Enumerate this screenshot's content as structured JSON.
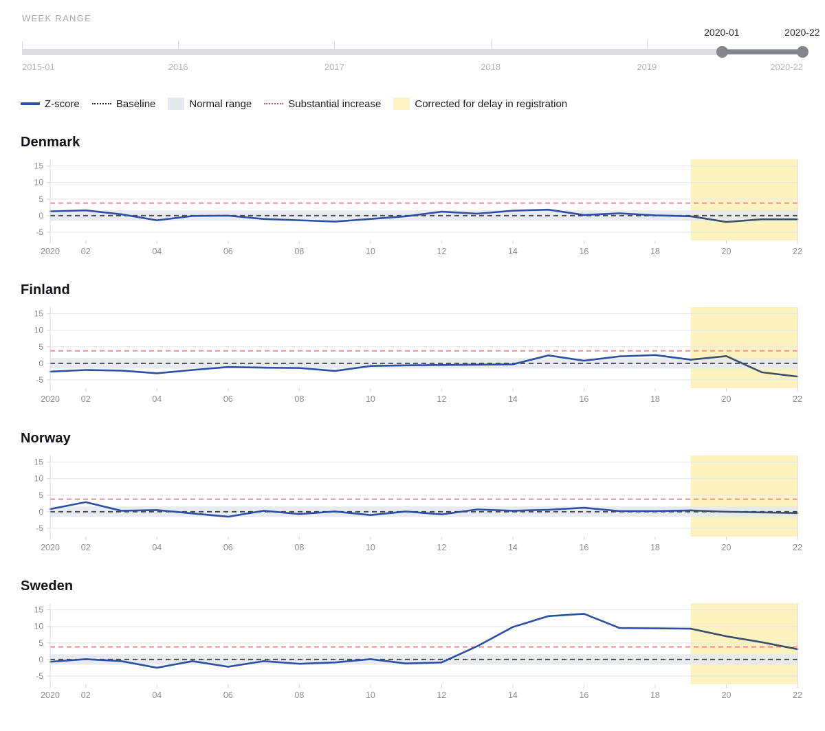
{
  "slider": {
    "label": "WEEK RANGE",
    "min_label": "2015-01",
    "max_label": "2020-22",
    "selected_start": "2020-01",
    "selected_end": "2020-22",
    "ticks": [
      "2015-01",
      "2016",
      "2017",
      "2018",
      "2019",
      "2020-22"
    ],
    "track_color": "#dcdcde",
    "fill_color": "#84848c",
    "handle_color": "#84848c"
  },
  "legend": {
    "items": [
      {
        "label": "Z-score",
        "type": "line",
        "color": "#2b4fa2"
      },
      {
        "label": "Baseline",
        "type": "dotted",
        "color": "#2b2b30"
      },
      {
        "label": "Normal range",
        "type": "swatch",
        "color": "#e4e9ef"
      },
      {
        "label": "Substantial increase",
        "type": "dotted-red",
        "color": "#e0555f"
      },
      {
        "label": "Corrected for delay in registration",
        "type": "swatch",
        "color": "#fcf2c4"
      }
    ]
  },
  "chart_data": [
    {
      "type": "line",
      "title": "Denmark",
      "xlabel": "",
      "ylabel": "",
      "x": [
        1,
        2,
        3,
        4,
        5,
        6,
        7,
        8,
        9,
        10,
        11,
        12,
        13,
        14,
        15,
        16,
        17,
        18,
        19,
        20,
        21,
        22
      ],
      "xtick_values": [
        1,
        2,
        4,
        6,
        8,
        10,
        12,
        14,
        16,
        18,
        20,
        22
      ],
      "xtick_labels": [
        "2020",
        "02",
        "04",
        "06",
        "08",
        "10",
        "12",
        "14",
        "16",
        "18",
        "20",
        "22"
      ],
      "ytick_values": [
        -5,
        0,
        5,
        10,
        15
      ],
      "ytick_labels": [
        "-5",
        "0",
        "5",
        "10",
        "15"
      ],
      "ylim": [
        -7.5,
        17.0
      ],
      "xlim": [
        1,
        22
      ],
      "series": [
        {
          "name": "Z-score",
          "values": [
            1.3,
            1.6,
            0.4,
            -1.4,
            -0.1,
            0.0,
            -1.0,
            -1.4,
            -1.8,
            -1.0,
            -0.2,
            1.2,
            0.6,
            1.5,
            1.8,
            0.2,
            0.7,
            0.1,
            -0.2,
            -1.9,
            -1.1,
            -1.1
          ]
        }
      ],
      "baseline": 0,
      "normal_range": [
        -1.6,
        1.6
      ],
      "substantial_increase": 3.8,
      "corrected_from": 19,
      "grid": true
    },
    {
      "type": "line",
      "title": "Finland",
      "xlabel": "",
      "ylabel": "",
      "x": [
        1,
        2,
        3,
        4,
        5,
        6,
        7,
        8,
        9,
        10,
        11,
        12,
        13,
        14,
        15,
        16,
        17,
        18,
        19,
        20,
        21,
        22
      ],
      "xtick_values": [
        1,
        2,
        4,
        6,
        8,
        10,
        12,
        14,
        16,
        18,
        20,
        22
      ],
      "xtick_labels": [
        "2020",
        "02",
        "04",
        "06",
        "08",
        "10",
        "12",
        "14",
        "16",
        "18",
        "20",
        "22"
      ],
      "ytick_values": [
        -5,
        0,
        5,
        10,
        15
      ],
      "ytick_labels": [
        "-5",
        "0",
        "5",
        "10",
        "15"
      ],
      "ylim": [
        -7.5,
        17.0
      ],
      "xlim": [
        1,
        22
      ],
      "series": [
        {
          "name": "Z-score",
          "values": [
            -2.5,
            -2.0,
            -2.2,
            -3.0,
            -2.0,
            -1.1,
            -1.3,
            -1.4,
            -2.3,
            -0.8,
            -0.6,
            -0.5,
            -0.4,
            -0.3,
            2.4,
            0.8,
            2.1,
            2.5,
            1.1,
            2.2,
            -2.7,
            -4.0
          ]
        }
      ],
      "baseline": 0,
      "normal_range": [
        -1.6,
        1.6
      ],
      "substantial_increase": 3.8,
      "corrected_from": 19,
      "grid": true
    },
    {
      "type": "line",
      "title": "Norway",
      "xlabel": "",
      "ylabel": "",
      "x": [
        1,
        2,
        3,
        4,
        5,
        6,
        7,
        8,
        9,
        10,
        11,
        12,
        13,
        14,
        15,
        16,
        17,
        18,
        19,
        20,
        21,
        22
      ],
      "xtick_values": [
        1,
        2,
        4,
        6,
        8,
        10,
        12,
        14,
        16,
        18,
        20,
        22
      ],
      "xtick_labels": [
        "2020",
        "02",
        "04",
        "06",
        "08",
        "10",
        "12",
        "14",
        "16",
        "18",
        "20",
        "22"
      ],
      "ytick_values": [
        -5,
        0,
        5,
        10,
        15
      ],
      "ytick_labels": [
        "-5",
        "0",
        "5",
        "10",
        "15"
      ],
      "ylim": [
        -7.5,
        17.0
      ],
      "xlim": [
        1,
        22
      ],
      "series": [
        {
          "name": "Z-score",
          "values": [
            0.8,
            2.9,
            0.3,
            0.5,
            -0.5,
            -1.5,
            0.3,
            -0.7,
            0.1,
            -1.0,
            0.1,
            -0.8,
            0.7,
            0.3,
            0.6,
            1.2,
            0.2,
            0.2,
            0.4,
            0.0,
            -0.2,
            -0.4
          ]
        }
      ],
      "baseline": 0,
      "normal_range": [
        -1.6,
        1.6
      ],
      "substantial_increase": 3.8,
      "corrected_from": 19,
      "grid": true
    },
    {
      "type": "line",
      "title": "Sweden",
      "xlabel": "",
      "ylabel": "",
      "x": [
        1,
        2,
        3,
        4,
        5,
        6,
        7,
        8,
        9,
        10,
        11,
        12,
        13,
        14,
        15,
        16,
        17,
        18,
        19,
        20,
        21,
        22
      ],
      "xtick_values": [
        1,
        2,
        4,
        6,
        8,
        10,
        12,
        14,
        16,
        18,
        20,
        22
      ],
      "xtick_labels": [
        "2020",
        "02",
        "04",
        "06",
        "08",
        "10",
        "12",
        "14",
        "16",
        "18",
        "20",
        "22"
      ],
      "ytick_values": [
        -5,
        0,
        5,
        10,
        15
      ],
      "ytick_labels": [
        "-5",
        "0",
        "5",
        "10",
        "15"
      ],
      "ylim": [
        -7.5,
        17.0
      ],
      "xlim": [
        1,
        22
      ],
      "series": [
        {
          "name": "Z-score",
          "values": [
            -0.7,
            0.1,
            -0.5,
            -2.5,
            -0.5,
            -2.2,
            -0.5,
            -1.3,
            -0.9,
            0.1,
            -1.2,
            -0.9,
            4.0,
            9.8,
            13.1,
            13.8,
            9.5,
            9.4,
            9.3,
            7.0,
            5.2,
            3.1
          ]
        }
      ],
      "baseline": 0,
      "normal_range": [
        -1.6,
        1.6
      ],
      "substantial_increase": 3.8,
      "corrected_from": 19,
      "grid": true
    }
  ],
  "colors": {
    "line": "#2b4fa2",
    "line_corrected": "#3b5068",
    "baseline": "#4a4a52",
    "normal_range": "#e4e9ef",
    "substantial": "#ef8a92",
    "corrected_band": "#fbf2c0",
    "grid": "#e6e6e8",
    "axis_text": "#8d8d93",
    "plot_border": "#d6d6da"
  }
}
